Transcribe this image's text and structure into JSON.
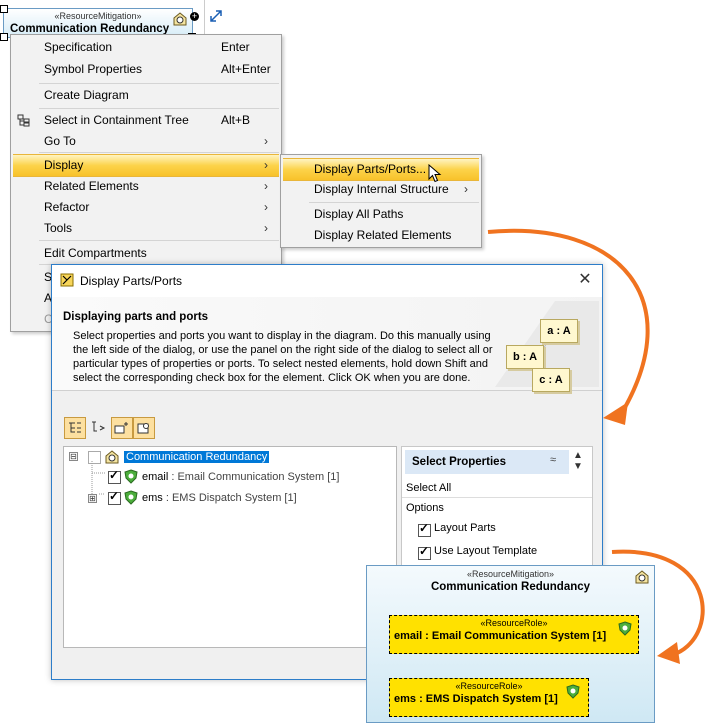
{
  "top_element": {
    "stereotype": "«ResourceMitigation»",
    "name": "Communication Redundancy",
    "icons": [
      "resource-mitigation-icon",
      "add-handle-icon",
      "diagonal-arrow-icon"
    ]
  },
  "context_menu": {
    "items": [
      {
        "label": "Specification",
        "shortcut": "Enter"
      },
      {
        "label": "Symbol Properties",
        "shortcut": "Alt+Enter"
      },
      {
        "label": "Create Diagram"
      },
      {
        "label": "Select in Containment Tree",
        "shortcut": "Alt+B"
      },
      {
        "label": "Go To",
        "submenu": "›"
      },
      {
        "label": "Display",
        "submenu": "›"
      },
      {
        "label": "Related Elements",
        "submenu": "›"
      },
      {
        "label": "Refactor",
        "submenu": "›"
      },
      {
        "label": "Tools",
        "submenu": "›"
      },
      {
        "label": "Edit Compartments"
      },
      {
        "label": "S"
      },
      {
        "label": "A"
      },
      {
        "label": "C"
      }
    ]
  },
  "submenu": {
    "items": [
      {
        "label": "Display Parts/Ports..."
      },
      {
        "label": "Display Internal Structure",
        "submenu": "›"
      },
      {
        "label": "Display All Paths"
      },
      {
        "label": "Display Related Elements"
      }
    ]
  },
  "dialog": {
    "title": "Display Parts/Ports",
    "close": "✕",
    "heading": "Displaying parts and ports",
    "description": "Select properties and ports you want to display in the diagram. Do this manually using the left side of the dialog, or use the panel on the right side of the dialog to select all or particular types of properties or ports. To select nested elements, hold down Shift and select the corresponding check box for the element. Click OK when you are done.",
    "illustration": [
      "a : A",
      "b : A",
      "c : A"
    ],
    "tree": {
      "root": "Communication Redundancy",
      "children": [
        {
          "name": "email",
          "type": " : Email Communication System [1]"
        },
        {
          "name": "ems",
          "type": " : EMS Dispatch System [1]"
        }
      ],
      "expanders": [
        "⊟",
        "⊞"
      ]
    },
    "properties": {
      "title": "Select Properties",
      "collapse": "≈",
      "select_all": "Select All",
      "options_label": "Options",
      "options": [
        {
          "label": "Layout Parts",
          "checked": true
        },
        {
          "label": "Use Layout Template",
          "checked": true
        }
      ]
    }
  },
  "result_diagram": {
    "stereotype": "«ResourceMitigation»",
    "name": "Communication Redundancy",
    "parts": [
      {
        "stereotype": "«ResourceRole»",
        "label": "email : Email Communication System [1]"
      },
      {
        "stereotype": "«ResourceRole»",
        "label": "ems : EMS Dispatch System [1]"
      }
    ]
  },
  "colors": {
    "menu_highlight": "#f8c22a",
    "arrow": "#f07320",
    "selection": "#0078d7",
    "part_fill": "#ffe100",
    "element_border": "#6a9bc4"
  }
}
